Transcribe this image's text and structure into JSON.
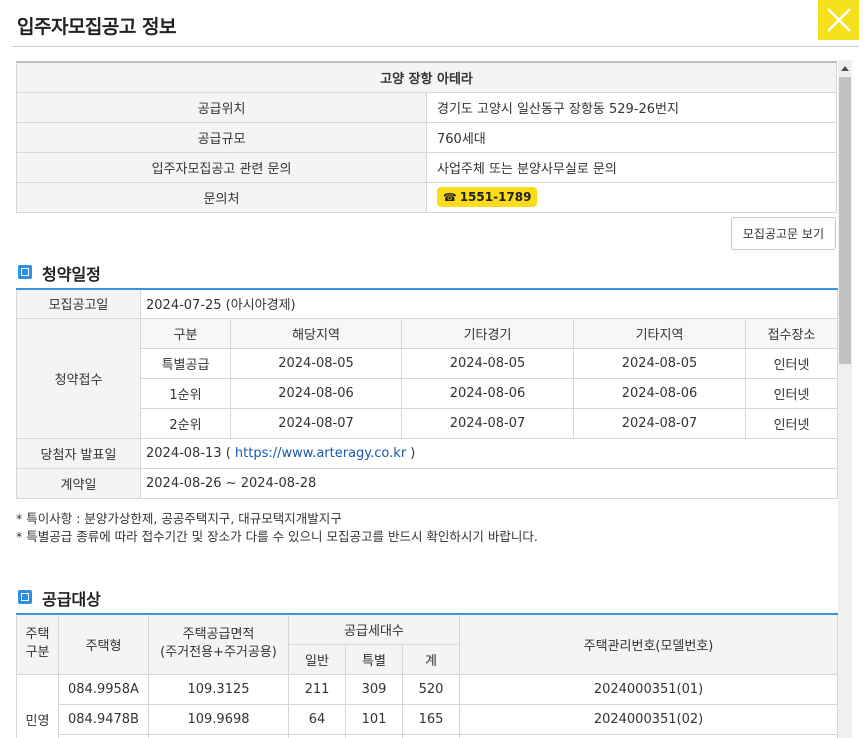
{
  "header": {
    "title": "입주자모집공고 정보"
  },
  "info": {
    "caption": "고양 장항 아테라",
    "rows": [
      {
        "label": "공급위치",
        "value": "경기도 고양시 일산동구 장항동 529-26번지"
      },
      {
        "label": "공급규모",
        "value": "760세대"
      },
      {
        "label": "입주자모집공고 관련 문의",
        "value": "사업주체 또는 분양사무실로 문의"
      }
    ],
    "contact_label": "문의처",
    "phone_icon": "☎",
    "phone": "1551-1789",
    "notice_button": "모집공고문 보기"
  },
  "schedule": {
    "title": "청약일정",
    "announce_label": "모집공고일",
    "announce_value": "2024-07-25 (아시아경제)",
    "receipt_label": "청약접수",
    "headers": [
      "구분",
      "해당지역",
      "기타경기",
      "기타지역",
      "접수장소"
    ],
    "rows": [
      [
        "특별공급",
        "2024-08-05",
        "2024-08-05",
        "2024-08-05",
        "인터넷"
      ],
      [
        "1순위",
        "2024-08-06",
        "2024-08-06",
        "2024-08-06",
        "인터넷"
      ],
      [
        "2순위",
        "2024-08-07",
        "2024-08-07",
        "2024-08-07",
        "인터넷"
      ]
    ],
    "winner_label": "당첨자 발표일",
    "winner_date": "2024-08-13",
    "winner_paren_open": " ( ",
    "winner_link": "https://www.arteragy.co.kr",
    "winner_paren_close": " )",
    "contract_label": "계약일",
    "contract_value": "2024-08-26 ~ 2024-08-28"
  },
  "notes": [
    "* 특이사항 : 분양가상한제, 공공주택지구, 대규모택지개발지구",
    "* 특별공급 종류에 따라 접수기간 및 장소가 다를 수 있으니 모집공고를 반드시 확인하시기 바랍니다."
  ],
  "supply": {
    "title": "공급대상",
    "headers": {
      "type_group": "주택\n구분",
      "house_type": "주택형",
      "area_line1": "주택공급면적",
      "area_line2": "(주거전용+주거공용)",
      "units": "공급세대수",
      "general": "일반",
      "special": "특별",
      "total": "계",
      "mgmt_no": "주택관리번호(모델번호)"
    },
    "group": "민영",
    "rows": [
      {
        "type": "084.9958A",
        "area": "109.3125",
        "general": "211",
        "special": "309",
        "total": "520",
        "mgmt": "2024000351(01)"
      },
      {
        "type": "084.9478B",
        "area": "109.9698",
        "general": "64",
        "special": "101",
        "total": "165",
        "mgmt": "2024000351(02)"
      }
    ]
  }
}
